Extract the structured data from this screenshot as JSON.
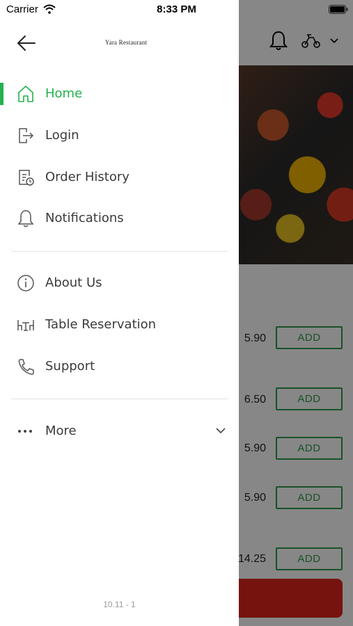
{
  "status_bar": {
    "carrier": "Carrier",
    "time": "8:33 PM"
  },
  "drawer": {
    "brand": "Yara Restaurant",
    "primary_items": [
      {
        "label": "Home",
        "icon": "home-icon",
        "active": true
      },
      {
        "label": "Login",
        "icon": "login-icon"
      },
      {
        "label": "Order History",
        "icon": "order-history-icon"
      },
      {
        "label": "Notifications",
        "icon": "bell-icon"
      }
    ],
    "secondary_items": [
      {
        "label": "About Us",
        "icon": "info-icon"
      },
      {
        "label": "Table Reservation",
        "icon": "table-icon"
      },
      {
        "label": "Support",
        "icon": "phone-icon"
      }
    ],
    "more_label": "More",
    "version": "10.11 - 1"
  },
  "background": {
    "items": [
      {
        "price": "5.90",
        "button": "ADD"
      },
      {
        "price": "6.50",
        "button": "ADD"
      },
      {
        "price": "5.90",
        "button": "ADD"
      },
      {
        "price": "5.90",
        "button": "ADD"
      },
      {
        "price": "14.25",
        "button": "ADD"
      }
    ]
  },
  "colors": {
    "accent": "#22b14c",
    "cart": "#e0251c",
    "add_button": "#2e9a4e"
  }
}
